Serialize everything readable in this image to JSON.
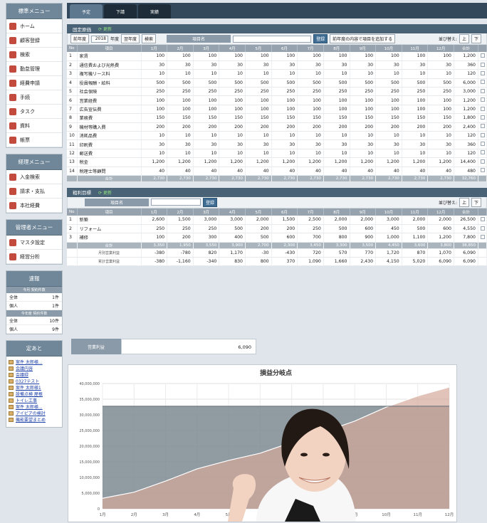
{
  "sidebar": {
    "std_menu": {
      "title": "標準メニュー",
      "items": [
        "ホーム",
        "顧客登録",
        "検索",
        "勤怠管理",
        "経費申請",
        "手続",
        "タスク",
        "資料",
        "帳票"
      ]
    },
    "acct_menu": {
      "title": "経理メニュー",
      "items": [
        "入金検索",
        "請求・支払",
        "本社経費"
      ]
    },
    "admin_menu": {
      "title": "管理者メニュー",
      "items": [
        "マスタ設定",
        "経営分析"
      ]
    },
    "stats": {
      "title": "速報",
      "h1": "今月 契約件数",
      "rows1": [
        [
          "全体",
          "1件"
        ],
        [
          "個人",
          "1件"
        ]
      ],
      "h2": "今年度 契約件数",
      "rows2": [
        [
          "全体",
          "10件"
        ],
        [
          "個人",
          "9件"
        ]
      ]
    },
    "bookmarks": {
      "title": "定あと",
      "items": [
        "案件 太郎様...",
        "会議内容",
        "会議録",
        "0327テスト",
        "案件 太郎様1",
        "設備点検 屋根",
        "トイレ工事",
        "案件 太郎様...",
        "アイピアの検討",
        "機能要望まとめ"
      ]
    }
  },
  "tabs": [
    "予定",
    "下請",
    "実績"
  ],
  "fixed": {
    "title": "固定原価",
    "reload": "更新",
    "prev_label": "前年度",
    "year": "2018",
    "year_suffix": "年度",
    "next_label": "翌年度",
    "search_label": "検索",
    "item_name_label": "項目名",
    "register_label": "登録",
    "copy_label": "前年度の内容で項目を追加する",
    "order_label": "並び替え:",
    "headers": [
      "No",
      "項目",
      "1月",
      "2月",
      "3月",
      "4月",
      "5月",
      "6月",
      "7月",
      "8月",
      "9月",
      "10月",
      "11月",
      "12月",
      "合計"
    ],
    "rows": [
      [
        "1",
        "家賃",
        "100",
        "100",
        "100",
        "100",
        "100",
        "100",
        "100",
        "100",
        "100",
        "100",
        "100",
        "100",
        "1,200"
      ],
      [
        "2",
        "通信費および光熱費",
        "30",
        "30",
        "30",
        "30",
        "30",
        "30",
        "30",
        "30",
        "30",
        "30",
        "30",
        "30",
        "360"
      ],
      [
        "3",
        "複写機リース料",
        "10",
        "10",
        "10",
        "10",
        "10",
        "10",
        "10",
        "10",
        "10",
        "10",
        "10",
        "10",
        "120"
      ],
      [
        "4",
        "役員報酬・給料",
        "500",
        "500",
        "500",
        "500",
        "500",
        "500",
        "500",
        "500",
        "500",
        "500",
        "500",
        "500",
        "6,000"
      ],
      [
        "5",
        "社会保険",
        "250",
        "250",
        "250",
        "250",
        "250",
        "250",
        "250",
        "250",
        "250",
        "250",
        "250",
        "250",
        "3,000"
      ],
      [
        "6",
        "営業経費",
        "100",
        "100",
        "100",
        "100",
        "100",
        "100",
        "100",
        "100",
        "100",
        "100",
        "100",
        "100",
        "1,200"
      ],
      [
        "7",
        "広告宣伝費",
        "100",
        "100",
        "100",
        "100",
        "100",
        "100",
        "100",
        "100",
        "100",
        "100",
        "100",
        "100",
        "1,200"
      ],
      [
        "8",
        "業務費",
        "150",
        "150",
        "150",
        "150",
        "150",
        "150",
        "150",
        "150",
        "150",
        "150",
        "150",
        "150",
        "1,800"
      ],
      [
        "9",
        "機材等購入費",
        "200",
        "200",
        "200",
        "200",
        "200",
        "200",
        "200",
        "200",
        "200",
        "200",
        "200",
        "200",
        "2,400"
      ],
      [
        "10",
        "消耗品費",
        "10",
        "10",
        "10",
        "10",
        "10",
        "10",
        "10",
        "10",
        "10",
        "10",
        "10",
        "10",
        "120"
      ],
      [
        "11",
        "印刷費",
        "30",
        "30",
        "30",
        "30",
        "30",
        "30",
        "30",
        "30",
        "30",
        "30",
        "30",
        "30",
        "360"
      ],
      [
        "12",
        "郵送費",
        "10",
        "10",
        "10",
        "10",
        "10",
        "10",
        "10",
        "10",
        "10",
        "10",
        "10",
        "10",
        "120"
      ],
      [
        "13",
        "税金",
        "1,200",
        "1,200",
        "1,200",
        "1,200",
        "1,200",
        "1,200",
        "1,200",
        "1,200",
        "1,200",
        "1,200",
        "1,200",
        "1,200",
        "14,400"
      ],
      [
        "14",
        "税理士等顧問",
        "40",
        "40",
        "40",
        "40",
        "40",
        "40",
        "40",
        "40",
        "40",
        "40",
        "40",
        "40",
        "480"
      ]
    ],
    "total": [
      "",
      "合計",
      "2,730",
      "2,730",
      "2,730",
      "2,730",
      "2,730",
      "2,730",
      "2,730",
      "2,730",
      "2,730",
      "2,730",
      "2,730",
      "2,730",
      "32,760"
    ]
  },
  "gross": {
    "title": "粗利目標",
    "reload": "更新",
    "item_name_label": "項目名",
    "register_label": "登録",
    "order_label": "並び替え:",
    "headers": [
      "No",
      "項目",
      "1月",
      "2月",
      "3月",
      "4月",
      "5月",
      "6月",
      "7月",
      "8月",
      "9月",
      "10月",
      "11月",
      "12月",
      "合計"
    ],
    "rows": [
      [
        "1",
        "新築",
        "2,600",
        "1,500",
        "3,000",
        "3,000",
        "2,000",
        "1,500",
        "2,500",
        "2,000",
        "2,000",
        "3,000",
        "2,000",
        "2,000",
        "26,500"
      ],
      [
        "2",
        "リフォーム",
        "250",
        "250",
        "250",
        "500",
        "200",
        "200",
        "250",
        "500",
        "600",
        "450",
        "500",
        "600",
        "4,550"
      ],
      [
        "3",
        "補修",
        "100",
        "200",
        "300",
        "400",
        "500",
        "600",
        "700",
        "800",
        "900",
        "1,000",
        "1,100",
        "1,200",
        "7,800"
      ]
    ],
    "total": [
      "",
      "合計",
      "3,350",
      "1,950",
      "3,550",
      "3,900",
      "2,700",
      "2,300",
      "3,450",
      "3,300",
      "3,500",
      "4,450",
      "3,600",
      "3,800",
      "38,850"
    ],
    "monthly_label": "月別営業利益",
    "monthly": [
      "-380",
      "-780",
      "820",
      "1,170",
      "-30",
      "-430",
      "720",
      "570",
      "770",
      "1,720",
      "870",
      "1,070",
      "6,090"
    ],
    "cumulative_label": "累計営業利益",
    "cumulative": [
      "-380",
      "-1,160",
      "-340",
      "830",
      "800",
      "370",
      "1,090",
      "1,660",
      "2,430",
      "4,150",
      "5,020",
      "6,090",
      "6,090"
    ]
  },
  "profit_box": {
    "label": "営業利益",
    "value": "6,090"
  },
  "chart_data": {
    "type": "area",
    "title": "損益分岐点",
    "categories": [
      "1月",
      "2月",
      "3月",
      "4月",
      "5月",
      "6月",
      "7月",
      "8月",
      "9月",
      "10月",
      "11月",
      "12月"
    ],
    "yticks": [
      "40,000,000",
      "35,000,000",
      "30,000,000",
      "25,000,000",
      "20,000,000",
      "15,000,000",
      "10,000,000",
      "5,000,000",
      "0"
    ],
    "ylim": [
      0,
      40000000
    ],
    "series": [
      {
        "values": [
          3350000,
          5300000,
          8850000,
          12750000,
          15450000,
          17750000,
          21200000,
          24500000,
          28000000,
          32450000,
          36050000,
          38850000
        ],
        "color": "#d4a99b"
      },
      {
        "values": [
          32760000,
          32760000,
          32760000,
          32760000,
          32760000,
          32760000,
          32760000,
          32760000,
          32760000,
          32760000,
          32760000,
          32760000
        ],
        "color": "#7d8a92"
      }
    ],
    "grid": true
  },
  "colors": {
    "header": "#4a6275",
    "accent": "#3e6c93",
    "sidebar_head": "#6f8799"
  }
}
